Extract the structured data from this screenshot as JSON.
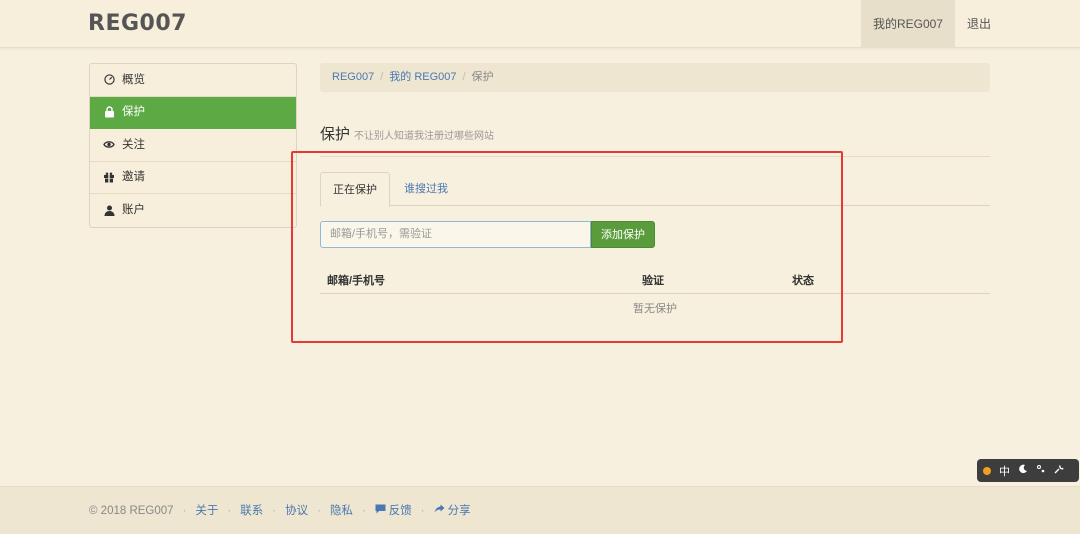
{
  "brand": "REG007",
  "nav": {
    "my_account": "我的REG007",
    "logout": "退出"
  },
  "sidebar": {
    "items": [
      {
        "label": "概览",
        "icon": "dashboard-icon"
      },
      {
        "label": "保护",
        "icon": "lock-icon",
        "active": true
      },
      {
        "label": "关注",
        "icon": "eye-icon"
      },
      {
        "label": "邀请",
        "icon": "gift-icon"
      },
      {
        "label": "账户",
        "icon": "user-icon"
      }
    ]
  },
  "breadcrumb": {
    "home": "REG007",
    "mine": "我的 REG007",
    "current": "保护"
  },
  "page": {
    "title": "保护",
    "subtitle": "不让别人知道我注册过哪些网站"
  },
  "tabs": {
    "active": "正在保护",
    "other": "谁搜过我"
  },
  "form": {
    "placeholder": "邮箱/手机号，需验证",
    "button": "添加保护"
  },
  "table": {
    "headers": [
      "邮箱/手机号",
      "验证",
      "状态"
    ],
    "empty": "暂无保护"
  },
  "footer": {
    "copyright": "© 2018 REG007",
    "links": [
      "关于",
      "联系",
      "协议",
      "隐私",
      "反馈",
      "分享"
    ]
  },
  "float_bar": {
    "lang": "中"
  },
  "colors": {
    "accent_green": "#5da943",
    "link_blue": "#4a78b0",
    "highlight_red": "#e53935"
  }
}
